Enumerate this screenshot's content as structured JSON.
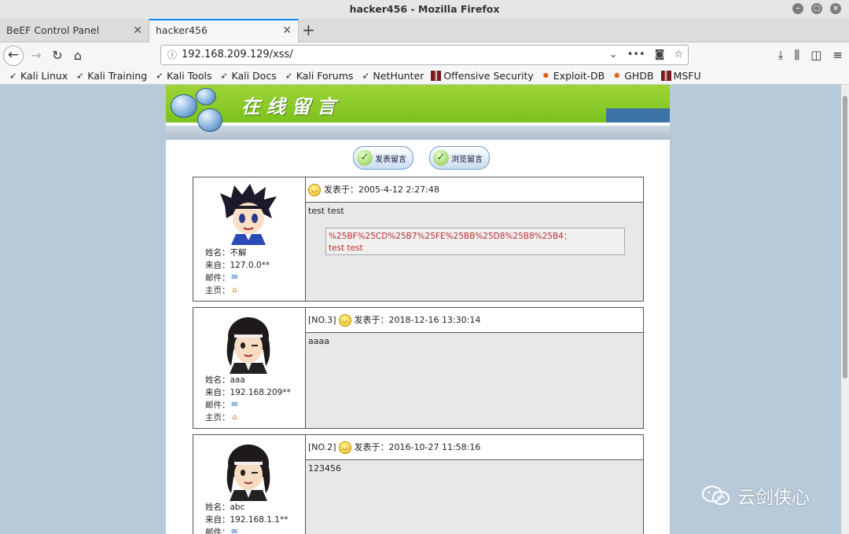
{
  "window": {
    "title": "hacker456 - Mozilla Firefox"
  },
  "tabs": [
    {
      "label": "BeEF Control Panel"
    },
    {
      "label": "hacker456"
    }
  ],
  "urlbar": {
    "url": "192.168.209.129/xss/"
  },
  "bookmarks": [
    {
      "label": "Kali Linux"
    },
    {
      "label": "Kali Training"
    },
    {
      "label": "Kali Tools"
    },
    {
      "label": "Kali Docs"
    },
    {
      "label": "Kali Forums"
    },
    {
      "label": "NetHunter"
    },
    {
      "label": "Offensive Security"
    },
    {
      "label": "Exploit-DB"
    },
    {
      "label": "GHDB"
    },
    {
      "label": "MSFU"
    }
  ],
  "site": {
    "banner_title": "在线留言",
    "post_button": "发表留言",
    "browse_button": "浏览留言"
  },
  "entries": [
    {
      "no": "",
      "posted": "发表于：2005-4-12 2:27:48",
      "message": "test test",
      "quote": "%25BF%25CD%25B7%25FE%25BB%25D8%25B8%25B4：",
      "quote_text": "test test",
      "name": "姓名：不解",
      "from": "来自：127.0.0**",
      "mail_label": "邮件：",
      "home_label": "主页："
    },
    {
      "no": "[NO.3]",
      "posted": "发表于：2018-12-16 13:30:14",
      "message": "aaaa",
      "name": "姓名：aaa",
      "from": "来自：192.168.209**",
      "mail_label": "邮件：",
      "home_label": "主页："
    },
    {
      "no": "[NO.2]",
      "posted": "发表于：2016-10-27 11:58:16",
      "message": "123456",
      "name": "姓名：abc",
      "from": "来自：192.168.1.1**",
      "mail_label": "邮件："
    }
  ],
  "watermark": {
    "text": "云剑侠心"
  }
}
